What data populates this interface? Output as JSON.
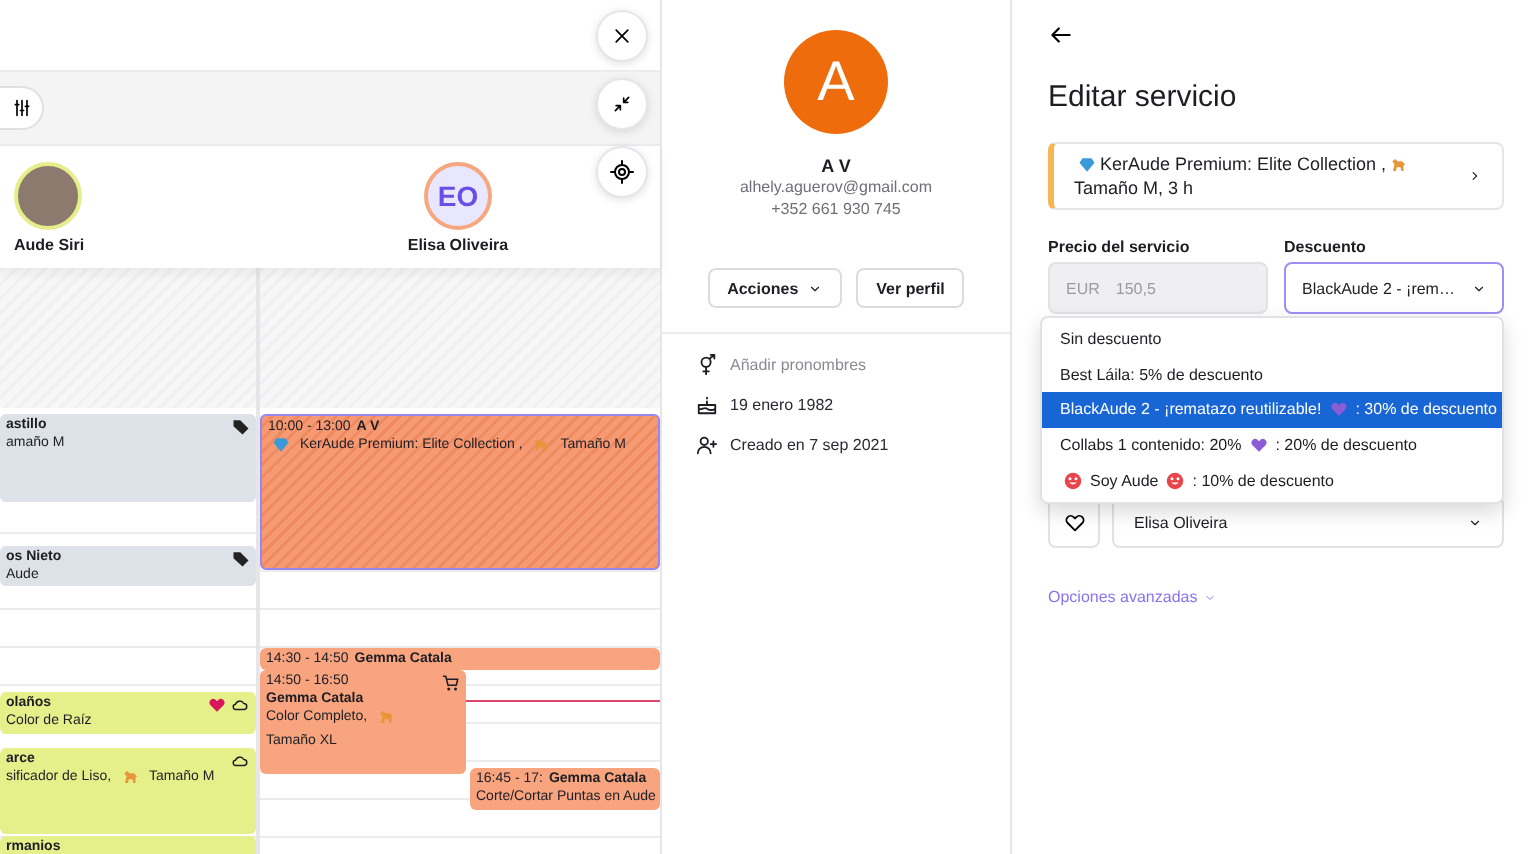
{
  "calendar": {
    "staff": [
      {
        "name": "Aude Siri",
        "kind": "photo",
        "color": "#e4ee8a"
      },
      {
        "name": "Elisa Oliveira",
        "kind": "initials",
        "initials": "EO",
        "color": "#f6a77f"
      }
    ],
    "columns": [
      {
        "events": [
          {
            "title": "astillo",
            "detail": [
              {
                "kind": "text",
                "text": "amaño M"
              }
            ],
            "color": "#dde1e8",
            "selected": false,
            "badges": [
              {
                "kind": "tag"
              }
            ]
          },
          {
            "title": "os Nieto",
            "detail": [
              {
                "kind": "text",
                "text": "Aude"
              }
            ],
            "color": "#dde1e8",
            "selected": false,
            "badges": [
              {
                "kind": "tag"
              }
            ]
          },
          {
            "title": "olaños",
            "detail": [
              {
                "kind": "text",
                "text": "Color de Raíz"
              }
            ],
            "color": "#e6f08a",
            "selected": false,
            "badges": [
              {
                "kind": "heart"
              },
              {
                "kind": "cloud"
              }
            ]
          },
          {
            "title": "arce",
            "detail": [
              {
                "kind": "text",
                "text": "sificador de Liso,"
              },
              {
                "kind": "dog"
              },
              {
                "kind": "text",
                "text": "Tamaño M"
              }
            ],
            "color": "#e6f08a",
            "selected": false,
            "badges": [
              {
                "kind": "cloud"
              }
            ]
          },
          {
            "title": "rmanios",
            "color": "#e6f08a",
            "selected": false
          }
        ]
      },
      {
        "events": [
          {
            "time": "10:00 - 13:00",
            "title": "A V",
            "detail": [
              {
                "kind": "gem"
              },
              {
                "kind": "text",
                "text": "KerAude Premium: Elite Collection ,"
              },
              {
                "kind": "dog"
              },
              {
                "kind": "text",
                "text": "Tamaño M"
              }
            ],
            "color": "#f59a72",
            "selected": true
          },
          {
            "time": "14:30 - 14:50",
            "title": "Gemma Catala",
            "color": "#f8a47e",
            "selected": false
          },
          {
            "time": "14:50 - 16:50",
            "title": "Gemma Catala",
            "detail": [
              {
                "kind": "text",
                "text": "Color Completo,"
              },
              {
                "kind": "dog"
              },
              {
                "kind": "text",
                "text": "Tamaño XL"
              }
            ],
            "color": "#f8a47e",
            "selected": false,
            "badges": [
              {
                "kind": "cart"
              }
            ]
          },
          {
            "time": "16:45 - 17:",
            "title": "Gemma Catala",
            "detail": [
              {
                "kind": "text",
                "text": "Corte/Cortar Puntas en Aude"
              }
            ],
            "color": "#f8a47e",
            "selected": false
          }
        ]
      }
    ]
  },
  "client": {
    "initial": "A",
    "name": "A V",
    "email": "alhely.aguerov@gmail.com",
    "phone": "+352 661 930 745",
    "actions": "Acciones",
    "profile": "Ver perfil",
    "info": [
      {
        "kind": "pronouns",
        "text": "Añadir pronombres",
        "muted": true
      },
      {
        "kind": "birthday",
        "text": "19 enero 1982",
        "muted": false
      },
      {
        "kind": "created",
        "text": "Creado en 7 sep 2021",
        "muted": false
      }
    ]
  },
  "editor": {
    "title": "Editar servicio",
    "service": [
      {
        "kind": "gem"
      },
      {
        "kind": "text",
        "text": "KerAude Premium: Elite Collection ,"
      },
      {
        "kind": "dog"
      },
      {
        "kind": "text",
        "text": "Tamaño M, 3 h"
      }
    ],
    "price": {
      "label": "Precio del servicio",
      "currency": "EUR",
      "value": "150,5",
      "disabled": true
    },
    "discount": {
      "label": "Descuento",
      "value": "BlackAude 2 - ¡rem…",
      "expanded": true,
      "options": [
        {
          "segments": [
            {
              "kind": "text",
              "text": "Sin descuento"
            }
          ],
          "selected": false
        },
        {
          "segments": [
            {
              "kind": "text",
              "text": "Best Láila: 5% de descuento"
            }
          ],
          "selected": false
        },
        {
          "segments": [
            {
              "kind": "text",
              "text": "BlackAude 2 - ¡rematazo reutilizable!"
            },
            {
              "kind": "heart"
            },
            {
              "kind": "text",
              "text": ": 30% de descuento"
            }
          ],
          "selected": true
        },
        {
          "segments": [
            {
              "kind": "text",
              "text": "Collabs 1 contenido: 20%"
            },
            {
              "kind": "heart"
            },
            {
              "kind": "text",
              "text": ": 20% de descuento"
            }
          ],
          "selected": false
        },
        {
          "segments": [
            {
              "kind": "smiley"
            },
            {
              "kind": "text",
              "text": "Soy Aude"
            },
            {
              "kind": "smiley"
            },
            {
              "kind": "text",
              "text": ": 10% de descuento"
            }
          ],
          "selected": false
        }
      ]
    },
    "favorite": false,
    "staff_value": "Elisa Oliveira",
    "advanced": "Opciones avanzadas"
  }
}
